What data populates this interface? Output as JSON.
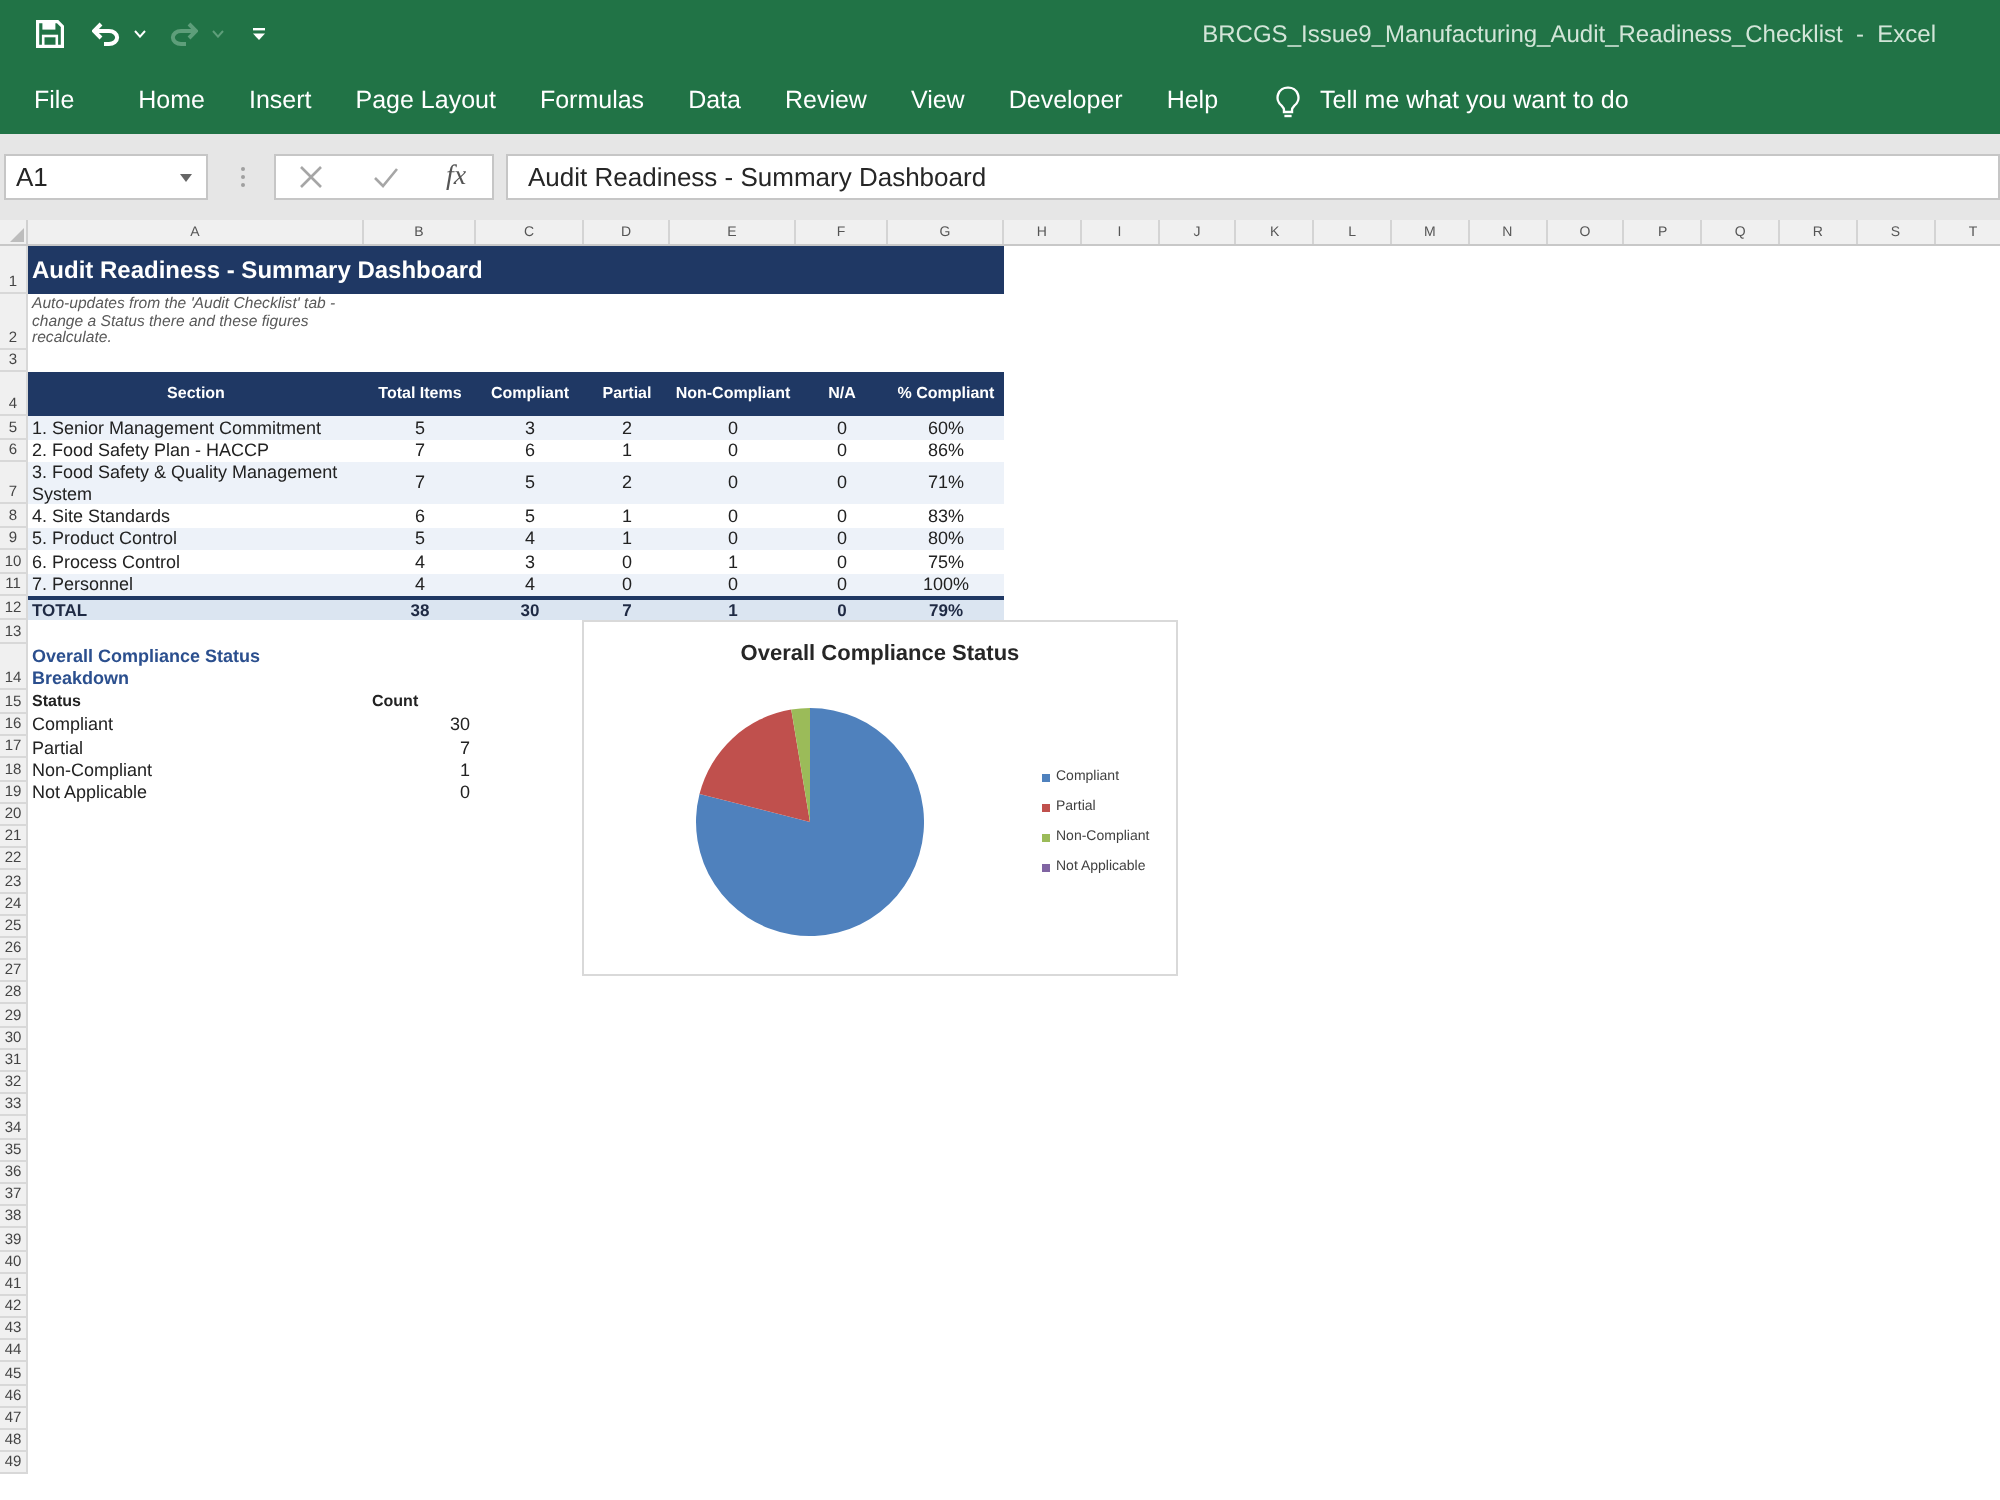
{
  "window": {
    "title": "BRCGS_Issue9_Manufacturing_Audit_Readiness_Checklist  -  Excel"
  },
  "quick_access": [
    {
      "kind": "save",
      "disabled": false
    },
    {
      "kind": "undo",
      "disabled": false
    },
    {
      "kind": "redo",
      "disabled": true
    },
    {
      "kind": "customize",
      "disabled": false
    }
  ],
  "ribbon_tabs": [
    "File",
    "Home",
    "Insert",
    "Page Layout",
    "Formulas",
    "Data",
    "Review",
    "View",
    "Developer",
    "Help"
  ],
  "tell_me": {
    "placeholder": "Tell me what you want to do"
  },
  "name_box": {
    "value": "A1"
  },
  "formula_bar": {
    "function_label": "fx",
    "value": "Audit Readiness - Summary Dashboard"
  },
  "column_headers": [
    "A",
    "B",
    "C",
    "D",
    "E",
    "F",
    "G",
    "H",
    "I",
    "J",
    "K",
    "L",
    "M",
    "N",
    "O",
    "P",
    "Q",
    "R",
    "S",
    "T"
  ],
  "row_headers": [
    "1",
    "2",
    "3",
    "4",
    "5",
    "6",
    "7",
    "8",
    "9",
    "10",
    "11",
    "12",
    "13",
    "14",
    "15",
    "16",
    "17",
    "18",
    "19",
    "20",
    "21",
    "22",
    "23",
    "24",
    "25",
    "26",
    "27",
    "28",
    "29",
    "30",
    "31",
    "32",
    "33",
    "34",
    "35",
    "36",
    "37",
    "38",
    "39",
    "40",
    "41",
    "42",
    "43",
    "44",
    "45",
    "46",
    "47",
    "48",
    "49"
  ],
  "sheet": {
    "title": "Audit Readiness - Summary Dashboard",
    "note": "Auto-updates from the 'Audit Checklist' tab - change a Status there and these figures recalculate.",
    "summary_table": {
      "columns": [
        "Section",
        "Total Items",
        "Compliant",
        "Partial",
        "Non-Compliant",
        "N/A",
        "% Compliant"
      ],
      "rows": [
        [
          "1. Senior Management Commitment",
          "5",
          "3",
          "2",
          "0",
          "0",
          "60%"
        ],
        [
          "2. Food Safety Plan - HACCP",
          "7",
          "6",
          "1",
          "0",
          "0",
          "86%"
        ],
        [
          "3. Food Safety & Quality Management System",
          "7",
          "5",
          "2",
          "0",
          "0",
          "71%"
        ],
        [
          "4. Site Standards",
          "6",
          "5",
          "1",
          "0",
          "0",
          "83%"
        ],
        [
          "5. Product Control",
          "5",
          "4",
          "1",
          "0",
          "0",
          "80%"
        ],
        [
          "6. Process Control",
          "4",
          "3",
          "0",
          "1",
          "0",
          "75%"
        ],
        [
          "7. Personnel",
          "4",
          "4",
          "0",
          "0",
          "0",
          "100%"
        ]
      ],
      "total": [
        "TOTAL",
        "38",
        "30",
        "7",
        "1",
        "0",
        "79%"
      ]
    },
    "breakdown": {
      "title": "Overall Compliance Status Breakdown",
      "columns": [
        "Status",
        "Count"
      ],
      "rows": [
        [
          "Compliant",
          "30"
        ],
        [
          "Partial",
          "7"
        ],
        [
          "Non-Compliant",
          "1"
        ],
        [
          "Not Applicable",
          "0"
        ]
      ]
    },
    "chart": {
      "chart_data": {
        "type": "pie",
        "title": "Overall Compliance Status",
        "categories": [
          "Compliant",
          "Partial",
          "Non-Compliant",
          "Not Applicable"
        ],
        "values": [
          78.95,
          18.42,
          2.63,
          0
        ],
        "colors": [
          "#4f81bd",
          "#c0504d",
          "#9bbb59",
          "#8064a2"
        ],
        "legend": "right"
      }
    }
  }
}
